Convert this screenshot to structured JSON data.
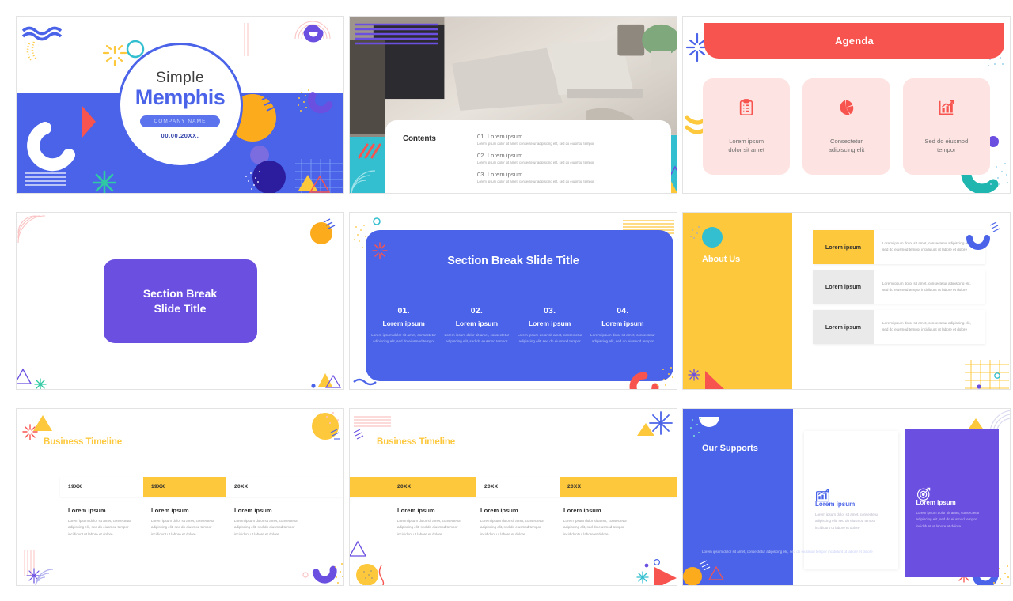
{
  "meta": {
    "colors": {
      "blue": "#4a63e8",
      "purple": "#6b4fe0",
      "yellow": "#fdc83c",
      "red": "#f8544f",
      "teal": "#34bfd0",
      "pink_light": "#fde3e1",
      "grey_light": "#eaeaea"
    },
    "lorem_short": "Lorem ipsum",
    "lorem_body": "Lorem ipsum dolor sit amet, consectetur adipiscing elit, sed do eiusmod tempor",
    "lorem_body_long": "Lorem ipsum dolor sit amet, consectetur adipiscing elit, sed do eiusmod tempor incididunt ut labore et dolore"
  },
  "slides": [
    {
      "id": "title-slide",
      "subtitle": "Simple",
      "title": "Memphis",
      "badge": "COMPANY NAME",
      "date": "00.00.20XX."
    },
    {
      "id": "contents-slide",
      "heading": "Contents",
      "items": [
        {
          "label": "01. Lorem ipsum",
          "body": "Lorem ipsum dolor sit amet, consectetur adipiscing elit, sed do eiusmod tempor"
        },
        {
          "label": "02. Lorem ipsum",
          "body": "Lorem ipsum dolor sit amet, consectetur adipiscing elit, sed do eiusmod tempor"
        },
        {
          "label": "03. Lorem ipsum",
          "body": "Lorem ipsum dolor sit amet, consectetur adipiscing elit, sed do eiusmod tempor"
        }
      ]
    },
    {
      "id": "agenda-slide",
      "heading": "Agenda",
      "cards": [
        {
          "icon": "clipboard-checklist-icon",
          "label": "Lorem ipsum\ndolor sit amet"
        },
        {
          "icon": "pie-chart-icon",
          "label": "Consectetur\nadipiscing elit"
        },
        {
          "icon": "bar-chart-growth-icon",
          "label": "Sed do eiusmod\ntempor"
        }
      ]
    },
    {
      "id": "section-break-slide",
      "title": "Section Break\nSlide Title"
    },
    {
      "id": "section-break-columns-slide",
      "title": "Section Break Slide Title",
      "columns": [
        {
          "num": "01.",
          "heading": "Lorem ipsum",
          "body": "Lorem ipsum dolor sit amet, consectetur adipiscing elit, sed do eiusmod tempor"
        },
        {
          "num": "02.",
          "heading": "Lorem ipsum",
          "body": "Lorem ipsum dolor sit amet, consectetur adipiscing elit, sed do eiusmod tempor"
        },
        {
          "num": "03.",
          "heading": "Lorem ipsum",
          "body": "Lorem ipsum dolor sit amet, consectetur adipiscing elit, sed do eiusmod tempor"
        },
        {
          "num": "04.",
          "heading": "Lorem ipsum",
          "body": "Lorem ipsum dolor sit amet, consectetur adipiscing elit, sed do eiusmod tempor"
        }
      ]
    },
    {
      "id": "about-us-slide",
      "title": "About Us",
      "rows": [
        {
          "tag": "Lorem ipsum",
          "highlight": true,
          "body": "Lorem ipsum dolor sit amet, consectetur adipiscing elit, sed do eiusmod tempor incididunt ut labore et dolore"
        },
        {
          "tag": "Lorem ipsum",
          "highlight": false,
          "body": "Lorem ipsum dolor sit amet, consectetur adipiscing elit, sed do eiusmod tempor incididunt ut labore et dolore"
        },
        {
          "tag": "Lorem ipsum",
          "highlight": false,
          "body": "Lorem ipsum dolor sit amet, consectetur adipiscing elit, sed do eiusmod tempor incididunt ut labore et dolore"
        }
      ]
    },
    {
      "id": "business-timeline-slide-1",
      "title_main": "Business ",
      "title_accent": "Timeline",
      "years": [
        {
          "label": "19XX",
          "highlight": false
        },
        {
          "label": "19XX",
          "highlight": true
        },
        {
          "label": "20XX",
          "highlight": false
        }
      ],
      "columns": [
        {
          "heading": "Lorem ipsum",
          "body": "Lorem ipsum dolor sit amet, consectetur adipiscing elit, sed do eiusmod tempor incididunt ut labore et dolore"
        },
        {
          "heading": "Lorem ipsum",
          "body": "Lorem ipsum dolor sit amet, consectetur adipiscing elit, sed do eiusmod tempor incididunt ut labore et dolore"
        },
        {
          "heading": "Lorem ipsum",
          "body": "Lorem ipsum dolor sit amet, consectetur adipiscing elit, sed do eiusmod tempor incididunt ut labore et dolore"
        }
      ]
    },
    {
      "id": "business-timeline-slide-2",
      "title_main": "Business ",
      "title_accent": "Timeline",
      "years": [
        {
          "label": "20XX",
          "highlight": true
        },
        {
          "label": "20XX",
          "highlight": false
        },
        {
          "label": "20XX",
          "highlight": true
        }
      ],
      "columns": [
        {
          "heading": "Lorem ipsum",
          "body": "Lorem ipsum dolor sit amet, consectetur adipiscing elit, sed do eiusmod tempor incididunt ut labore et dolore"
        },
        {
          "heading": "Lorem ipsum",
          "body": "Lorem ipsum dolor sit amet, consectetur adipiscing elit, sed do eiusmod tempor incididunt ut labore et dolore"
        },
        {
          "heading": "Lorem ipsum",
          "body": "Lorem ipsum dolor sit amet, consectetur adipiscing elit, sed do eiusmod tempor incididunt ut labore et dolore"
        }
      ]
    },
    {
      "id": "our-supports-slide",
      "title": "Our Supports",
      "body": "Lorem ipsum dolor sit amet, consectetur adipiscing elit, sed do eiusmod tempor incididunt ut labore et dolore",
      "cards": [
        {
          "icon": "bar-chart-growth-icon",
          "heading": "Lorem ipsum",
          "body": "Lorem ipsum dolor sit amet, consectetur adipiscing elit, sed do eiusmod tempor incididunt ut labore et dolore"
        },
        {
          "icon": "target-dartboard-icon",
          "heading": "Lorem ipsum",
          "body": "Lorem ipsum dolor sit amet, consectetur adipiscing elit, sed do eiusmod tempor incididunt ut labore et dolore"
        }
      ]
    }
  ]
}
